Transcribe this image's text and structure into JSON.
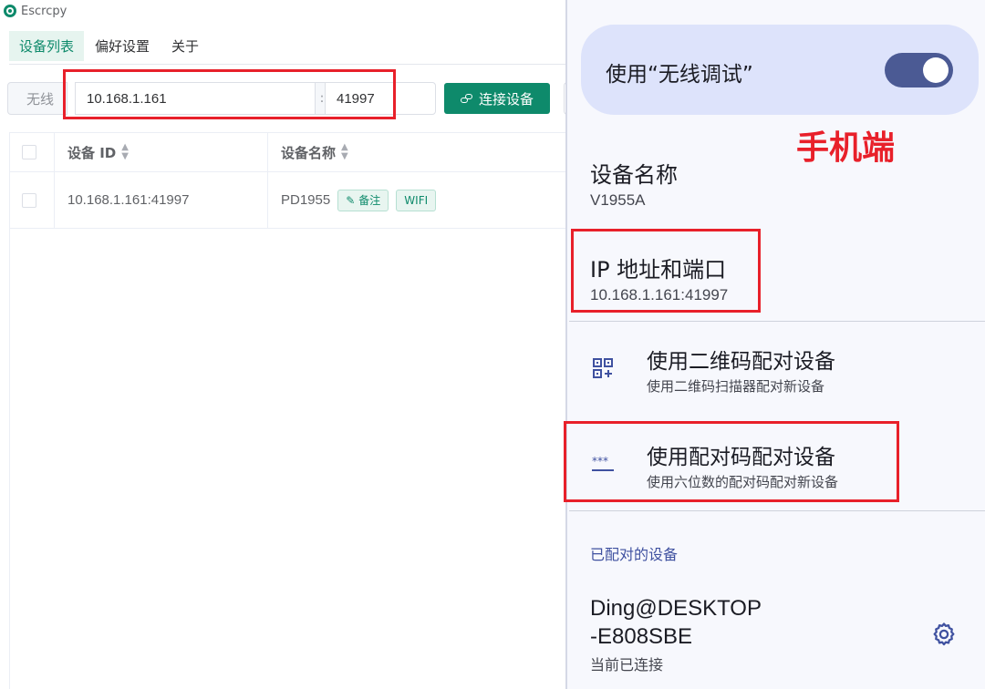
{
  "app": {
    "title": "Escrcpy",
    "icon": "escrcpy-logo-icon",
    "tabs": [
      {
        "label": "设备列表",
        "active": true
      },
      {
        "label": "偏好设置",
        "active": false
      },
      {
        "label": "关于",
        "active": false
      }
    ],
    "connect": {
      "mode_label": "无线",
      "ip_value": "10.168.1.161",
      "separator": ":",
      "port_value": "41997",
      "button_label": "连接设备",
      "button_icon": "link-icon"
    },
    "table": {
      "columns": [
        "设备 ID",
        "设备名称"
      ],
      "rows": [
        {
          "id": "10.168.1.161:41997",
          "name": "PD1955",
          "remark_label": "备注",
          "type_tag": "WIFI"
        }
      ]
    }
  },
  "phone": {
    "wireless_debug_label": "使用“无线调试”",
    "wireless_debug_on": true,
    "annotation": "手机端",
    "device_name_label": "设备名称",
    "device_name_value": "V1955A",
    "ip_label": "IP 地址和端口",
    "ip_value": "10.168.1.161:41997",
    "qr_pair": {
      "title": "使用二维码配对设备",
      "subtitle": "使用二维码扫描器配对新设备",
      "icon": "qr-code-icon"
    },
    "code_pair": {
      "title": "使用配对码配对设备",
      "subtitle": "使用六位数的配对码配对新设备",
      "icon": "password-icon"
    },
    "paired_section_label": "已配对的设备",
    "paired_device": {
      "name_line1": "Ding@DESKTOP",
      "name_line2": "-E808SBE",
      "status": "当前已连接",
      "icon": "gear-icon"
    }
  },
  "colors": {
    "brand_green": "#0e8a6b",
    "annotation_red": "#e8202a",
    "toggle_on": "#4b5a94",
    "card_bg": "#dde3fb"
  }
}
